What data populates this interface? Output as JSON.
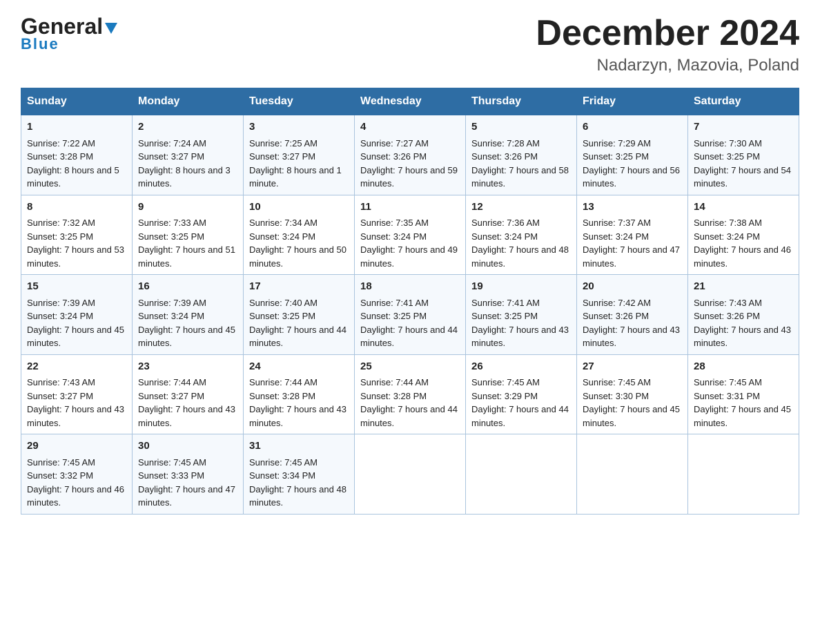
{
  "logo": {
    "general": "General",
    "blue": "Blue",
    "triangle": "▶"
  },
  "title": "December 2024",
  "subtitle": "Nadarzyn, Mazovia, Poland",
  "days": [
    "Sunday",
    "Monday",
    "Tuesday",
    "Wednesday",
    "Thursday",
    "Friday",
    "Saturday"
  ],
  "weeks": [
    [
      {
        "day": "1",
        "sunrise": "7:22 AM",
        "sunset": "3:28 PM",
        "daylight": "8 hours and 5 minutes."
      },
      {
        "day": "2",
        "sunrise": "7:24 AM",
        "sunset": "3:27 PM",
        "daylight": "8 hours and 3 minutes."
      },
      {
        "day": "3",
        "sunrise": "7:25 AM",
        "sunset": "3:27 PM",
        "daylight": "8 hours and 1 minute."
      },
      {
        "day": "4",
        "sunrise": "7:27 AM",
        "sunset": "3:26 PM",
        "daylight": "7 hours and 59 minutes."
      },
      {
        "day": "5",
        "sunrise": "7:28 AM",
        "sunset": "3:26 PM",
        "daylight": "7 hours and 58 minutes."
      },
      {
        "day": "6",
        "sunrise": "7:29 AM",
        "sunset": "3:25 PM",
        "daylight": "7 hours and 56 minutes."
      },
      {
        "day": "7",
        "sunrise": "7:30 AM",
        "sunset": "3:25 PM",
        "daylight": "7 hours and 54 minutes."
      }
    ],
    [
      {
        "day": "8",
        "sunrise": "7:32 AM",
        "sunset": "3:25 PM",
        "daylight": "7 hours and 53 minutes."
      },
      {
        "day": "9",
        "sunrise": "7:33 AM",
        "sunset": "3:25 PM",
        "daylight": "7 hours and 51 minutes."
      },
      {
        "day": "10",
        "sunrise": "7:34 AM",
        "sunset": "3:24 PM",
        "daylight": "7 hours and 50 minutes."
      },
      {
        "day": "11",
        "sunrise": "7:35 AM",
        "sunset": "3:24 PM",
        "daylight": "7 hours and 49 minutes."
      },
      {
        "day": "12",
        "sunrise": "7:36 AM",
        "sunset": "3:24 PM",
        "daylight": "7 hours and 48 minutes."
      },
      {
        "day": "13",
        "sunrise": "7:37 AM",
        "sunset": "3:24 PM",
        "daylight": "7 hours and 47 minutes."
      },
      {
        "day": "14",
        "sunrise": "7:38 AM",
        "sunset": "3:24 PM",
        "daylight": "7 hours and 46 minutes."
      }
    ],
    [
      {
        "day": "15",
        "sunrise": "7:39 AM",
        "sunset": "3:24 PM",
        "daylight": "7 hours and 45 minutes."
      },
      {
        "day": "16",
        "sunrise": "7:39 AM",
        "sunset": "3:24 PM",
        "daylight": "7 hours and 45 minutes."
      },
      {
        "day": "17",
        "sunrise": "7:40 AM",
        "sunset": "3:25 PM",
        "daylight": "7 hours and 44 minutes."
      },
      {
        "day": "18",
        "sunrise": "7:41 AM",
        "sunset": "3:25 PM",
        "daylight": "7 hours and 44 minutes."
      },
      {
        "day": "19",
        "sunrise": "7:41 AM",
        "sunset": "3:25 PM",
        "daylight": "7 hours and 43 minutes."
      },
      {
        "day": "20",
        "sunrise": "7:42 AM",
        "sunset": "3:26 PM",
        "daylight": "7 hours and 43 minutes."
      },
      {
        "day": "21",
        "sunrise": "7:43 AM",
        "sunset": "3:26 PM",
        "daylight": "7 hours and 43 minutes."
      }
    ],
    [
      {
        "day": "22",
        "sunrise": "7:43 AM",
        "sunset": "3:27 PM",
        "daylight": "7 hours and 43 minutes."
      },
      {
        "day": "23",
        "sunrise": "7:44 AM",
        "sunset": "3:27 PM",
        "daylight": "7 hours and 43 minutes."
      },
      {
        "day": "24",
        "sunrise": "7:44 AM",
        "sunset": "3:28 PM",
        "daylight": "7 hours and 43 minutes."
      },
      {
        "day": "25",
        "sunrise": "7:44 AM",
        "sunset": "3:28 PM",
        "daylight": "7 hours and 44 minutes."
      },
      {
        "day": "26",
        "sunrise": "7:45 AM",
        "sunset": "3:29 PM",
        "daylight": "7 hours and 44 minutes."
      },
      {
        "day": "27",
        "sunrise": "7:45 AM",
        "sunset": "3:30 PM",
        "daylight": "7 hours and 45 minutes."
      },
      {
        "day": "28",
        "sunrise": "7:45 AM",
        "sunset": "3:31 PM",
        "daylight": "7 hours and 45 minutes."
      }
    ],
    [
      {
        "day": "29",
        "sunrise": "7:45 AM",
        "sunset": "3:32 PM",
        "daylight": "7 hours and 46 minutes."
      },
      {
        "day": "30",
        "sunrise": "7:45 AM",
        "sunset": "3:33 PM",
        "daylight": "7 hours and 47 minutes."
      },
      {
        "day": "31",
        "sunrise": "7:45 AM",
        "sunset": "3:34 PM",
        "daylight": "7 hours and 48 minutes."
      },
      null,
      null,
      null,
      null
    ]
  ]
}
